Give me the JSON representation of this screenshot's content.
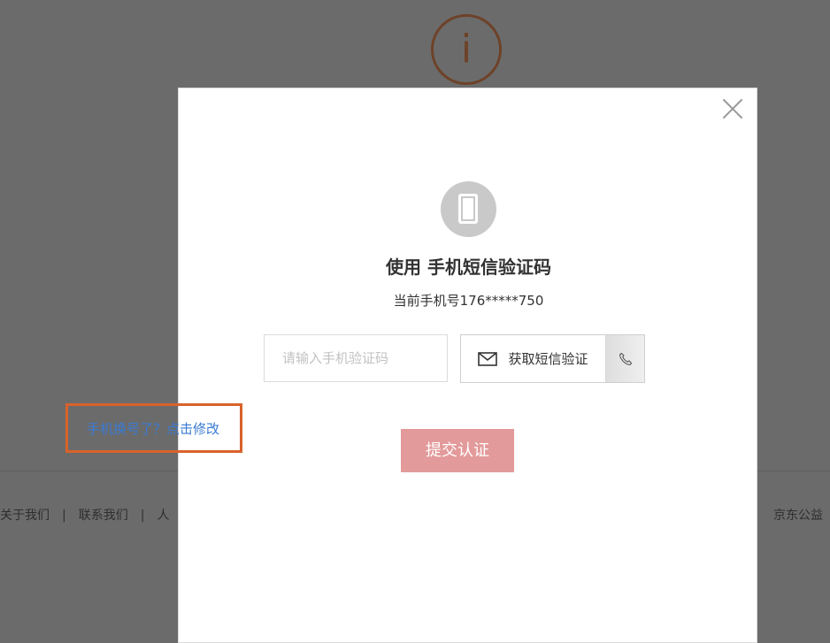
{
  "background": {
    "info_icon_glyph": "i",
    "footer_links": [
      "关于我们",
      "联系我们",
      "人"
    ],
    "footer_separators": [
      "|",
      "|"
    ],
    "footer_right": "京东公益"
  },
  "modal": {
    "close_glyph": "×",
    "title": "使用 手机短信验证码",
    "phone_label": "当前手机号176*****750",
    "code_input": {
      "placeholder": "请输入手机验证码",
      "value": ""
    },
    "sms_button_label": "获取短信验证",
    "submit_label": "提交认证",
    "change_phone_link": "手机换号了？点击修改"
  },
  "colors": {
    "overlay": "#6b6b6b",
    "submit": "#e39a9a",
    "link": "#3a7bd5",
    "highlight_box": "#d9622b",
    "info_icon": "#6e4228"
  },
  "icons": [
    "info-icon",
    "close-icon",
    "phone-icon",
    "mail-icon",
    "phone-call-icon"
  ]
}
